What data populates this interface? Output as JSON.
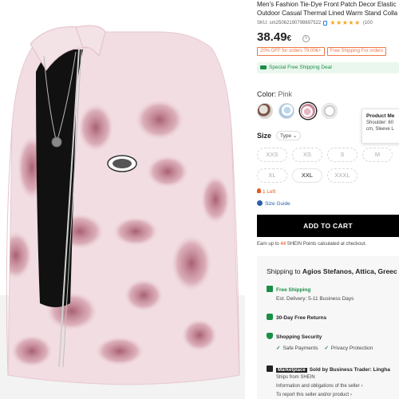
{
  "product": {
    "title_line1": "Men's Fashion Tie-Dye Front Patch Decor Elastic",
    "title_line2": "Outdoor Casual Thermal Lined Warm Stand Colla",
    "sku": "SKU: sm25062190798697522",
    "rating_stars": "★★★★★",
    "reviews_count": "(100",
    "price_main": "38.49",
    "price_currency": "€",
    "price_info_icon": "i",
    "promos": [
      "20% OFF for orders 79.00€+",
      "Free Shipping For orders"
    ],
    "shipping_banner": "Special Free Shipping Deal"
  },
  "color": {
    "label": "Color:",
    "value": "Pink",
    "swatches": [
      "brown-swatch",
      "blue-swatch",
      "pink-swatch",
      "grey-swatch"
    ],
    "selected": "pink-swatch"
  },
  "tooltip": {
    "title": "Product Me",
    "line1": "Shoulder: 60",
    "line2": "cm, Sleeve L"
  },
  "size": {
    "label": "Size",
    "type_label": "Type",
    "type_chevron": "⌄",
    "options": [
      {
        "label": "XXS",
        "available": false
      },
      {
        "label": "XS",
        "available": false
      },
      {
        "label": "S",
        "available": false
      },
      {
        "label": "M",
        "available": false
      },
      {
        "label": "XL",
        "available": false
      },
      {
        "label": "XXL",
        "available": true
      },
      {
        "label": "XXXL",
        "available": false
      }
    ],
    "stock_note": "1 Left",
    "guide_label": "Size Guide"
  },
  "cart": {
    "button_label": "ADD TO CART",
    "earn_prefix": "Earn up to",
    "earn_points": "44",
    "earn_suffix": "SHEIN Points calculated at checkout."
  },
  "shipping": {
    "title_prefix": "Shipping to",
    "title_location": "Agios Stefanos, Attica, Greec",
    "free_shipping": "Free Shipping",
    "delivery": "Est. Delivery: 5-11 Business Days",
    "returns": "30-Day Free Returns",
    "security": "Shopping Security",
    "safe_payments": "Safe Payments",
    "privacy": "Privacy Protection",
    "marketplace_badge": "Marketplace",
    "sold_by": "Sold by Business Trader: Lingha",
    "ships_from": "Ships from SHEIN",
    "info_link": "Information and obligations of the seller",
    "report_link": "To report this seller and/or product",
    "chevron": "›"
  },
  "colors": {
    "accent_orange": "#f07848",
    "success_green": "#1a8f46",
    "cart_black": "#000000",
    "star_gold": "#f5a623",
    "jacket_pink": "#c97b8e"
  }
}
